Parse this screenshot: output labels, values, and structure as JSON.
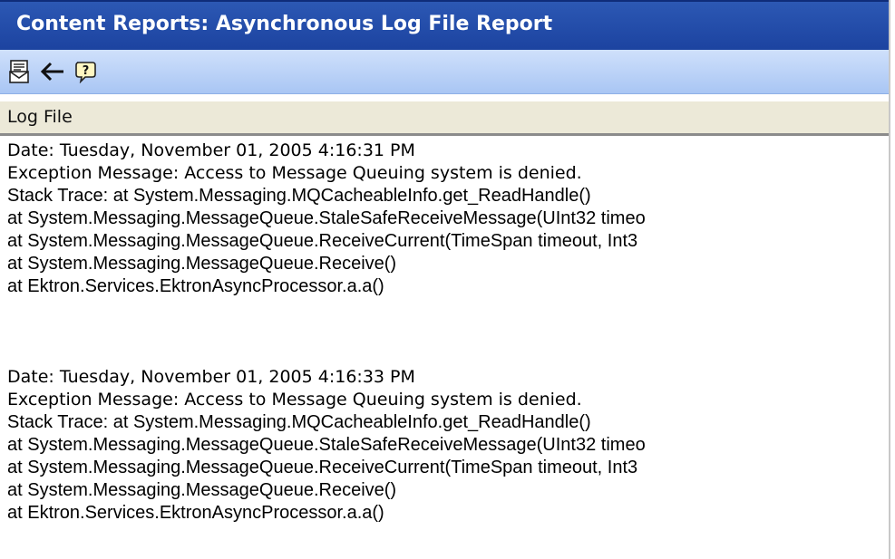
{
  "header": {
    "title": "Content Reports: Asynchronous Log File Report"
  },
  "toolbar": {
    "buttons": [
      {
        "icon": "email-report-icon"
      },
      {
        "icon": "back-arrow-icon"
      },
      {
        "icon": "help-icon"
      }
    ]
  },
  "section": {
    "title": "Log File"
  },
  "log": {
    "entries": [
      {
        "date": "Date: Tuesday, November 01, 2005 4:16:31 PM",
        "exception": "Exception Message: Access to Message Queuing system is denied.",
        "stack": [
          "Stack Trace: at System.Messaging.MQCacheableInfo.get_ReadHandle()",
          "at System.Messaging.MessageQueue.StaleSafeReceiveMessage(UInt32 timeo",
          "at System.Messaging.MessageQueue.ReceiveCurrent(TimeSpan timeout, Int3",
          "at System.Messaging.MessageQueue.Receive()",
          "at Ektron.Services.EktronAsyncProcessor.a.a()"
        ]
      },
      {
        "date": "Date: Tuesday, November 01, 2005 4:16:33 PM",
        "exception": "Exception Message: Access to Message Queuing system is denied.",
        "stack": [
          "Stack Trace: at System.Messaging.MQCacheableInfo.get_ReadHandle()",
          "at System.Messaging.MessageQueue.StaleSafeReceiveMessage(UInt32 timeo",
          "at System.Messaging.MessageQueue.ReceiveCurrent(TimeSpan timeout, Int3",
          "at System.Messaging.MessageQueue.Receive()",
          "at Ektron.Services.EktronAsyncProcessor.a.a()"
        ]
      }
    ]
  }
}
